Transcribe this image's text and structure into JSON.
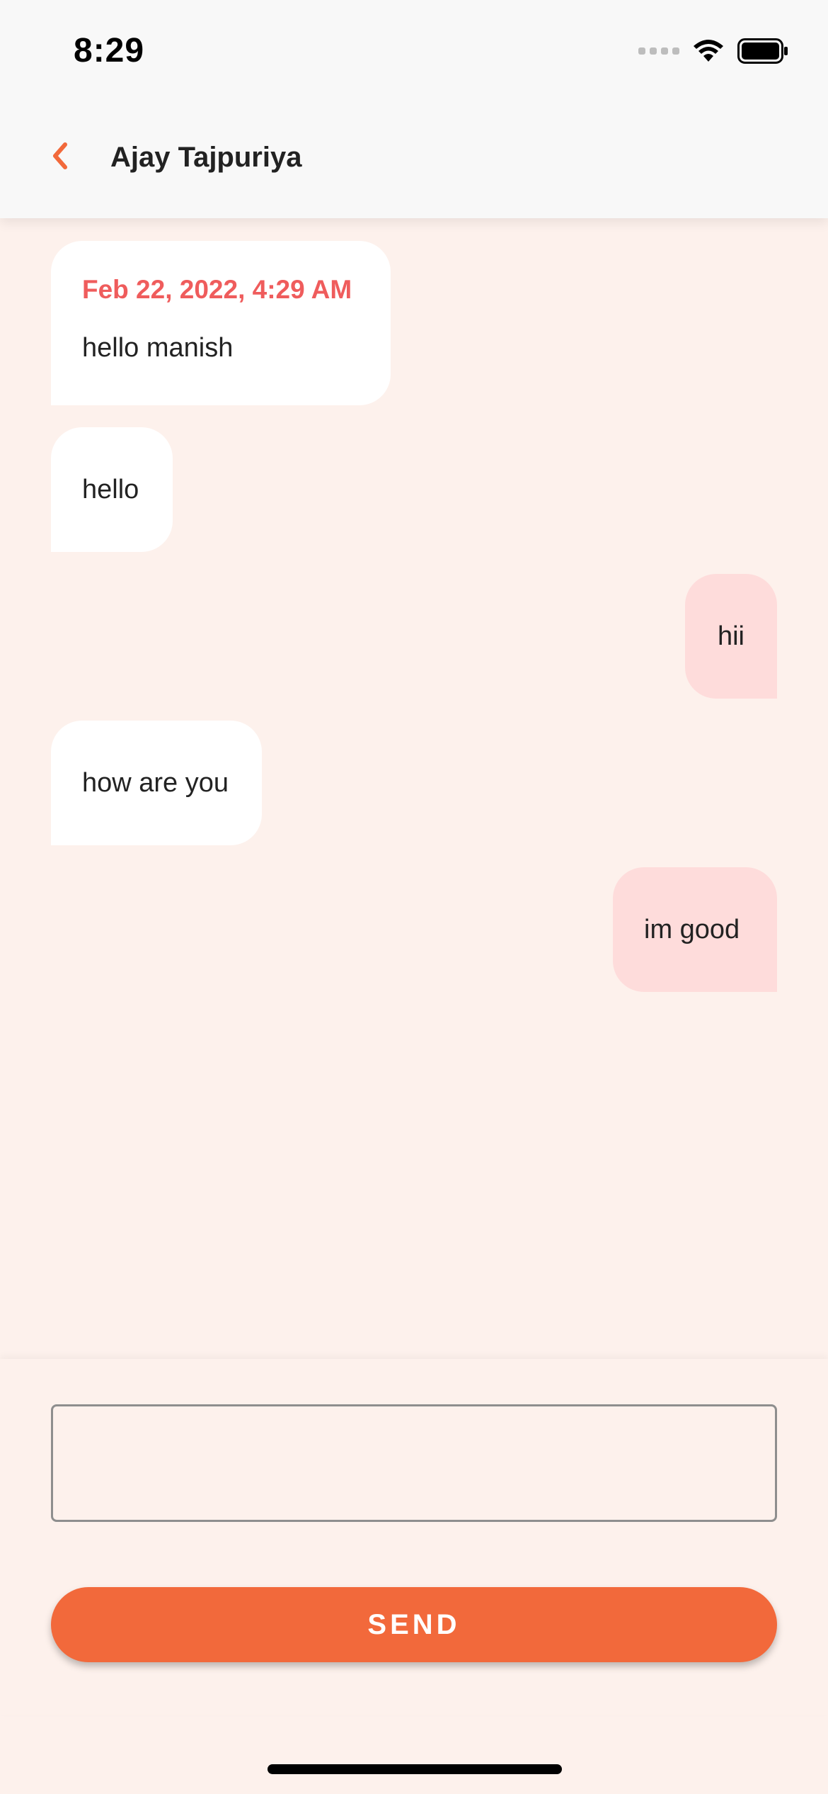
{
  "status_bar": {
    "time": "8:29"
  },
  "header": {
    "title": "Ajay Tajpuriya",
    "back_icon": "chevron-left-icon"
  },
  "messages": [
    {
      "direction": "incoming",
      "timestamp": "Feb 22, 2022, 4:29 AM",
      "text": "hello manish"
    },
    {
      "direction": "incoming",
      "text": "hello"
    },
    {
      "direction": "outgoing",
      "text": "hii"
    },
    {
      "direction": "incoming",
      "text": "how are you"
    },
    {
      "direction": "outgoing",
      "text": "im good"
    }
  ],
  "composer": {
    "input_value": "",
    "send_label": "SEND"
  },
  "colors": {
    "accent": "#f2693b",
    "background": "#fdf1ec",
    "incoming_bubble": "#ffffff",
    "outgoing_bubble": "#fedcdb",
    "timestamp": "#ef5c5c"
  }
}
